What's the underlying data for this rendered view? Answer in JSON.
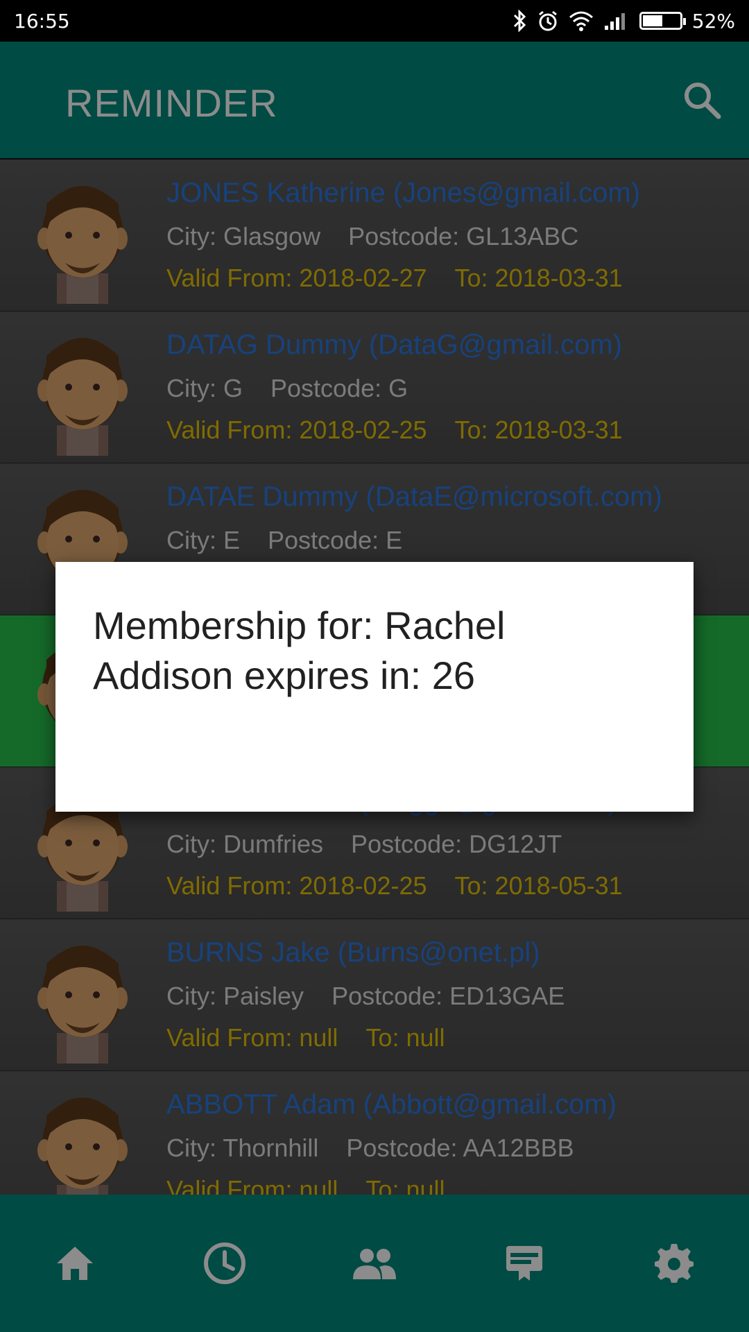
{
  "status_bar": {
    "time": "16:55",
    "battery": "52%"
  },
  "app_bar": {
    "title": "REMINDER"
  },
  "members": [
    {
      "name": "JONES Katherine (Jones@gmail.com)",
      "city": "City: Glasgow",
      "postcode": "Postcode: GL13ABC",
      "valid_from": "Valid From: 2018-02-27",
      "to": "To: 2018-03-31",
      "highlighted": false
    },
    {
      "name": "DATAG Dummy (DataG@gmail.com)",
      "city": "City: G",
      "postcode": "Postcode: G",
      "valid_from": "Valid From: 2018-02-25",
      "to": "To: 2018-03-31",
      "highlighted": false
    },
    {
      "name": "DATAE Dummy (DataE@microsoft.com)",
      "city": "City: E",
      "postcode": "Postcode: E",
      "valid_from": "",
      "to": "",
      "highlighted": false
    },
    {
      "name": "",
      "city": "",
      "postcode": "",
      "valid_from": "",
      "to": "",
      "highlighted": true
    },
    {
      "name": "BLOGGS John (Bloggs@gmail.com)",
      "city": "City: Dumfries",
      "postcode": "Postcode: DG12JT",
      "valid_from": "Valid From: 2018-02-25",
      "to": "To: 2018-05-31",
      "highlighted": false
    },
    {
      "name": "BURNS Jake (Burns@onet.pl)",
      "city": "City: Paisley",
      "postcode": "Postcode: ED13GAE",
      "valid_from": "Valid From: null",
      "to": "To: null",
      "highlighted": false
    },
    {
      "name": "ABBOTT Adam (Abbott@gmail.com)",
      "city": "City: Thornhill",
      "postcode": "Postcode: AA12BBB",
      "valid_from": "Valid From: null",
      "to": "To: null",
      "highlighted": false
    }
  ],
  "dialog": {
    "message": "Membership for: Rachel Addison expires in: 26"
  },
  "bottom_nav": [
    {
      "icon": "home-icon"
    },
    {
      "icon": "clock-icon"
    },
    {
      "icon": "people-icon"
    },
    {
      "icon": "card-icon"
    },
    {
      "icon": "gear-icon"
    }
  ],
  "colors": {
    "primary": "#00897b",
    "highlight": "#27c24c",
    "name": "#2b78e4",
    "valid": "#e8c400"
  }
}
